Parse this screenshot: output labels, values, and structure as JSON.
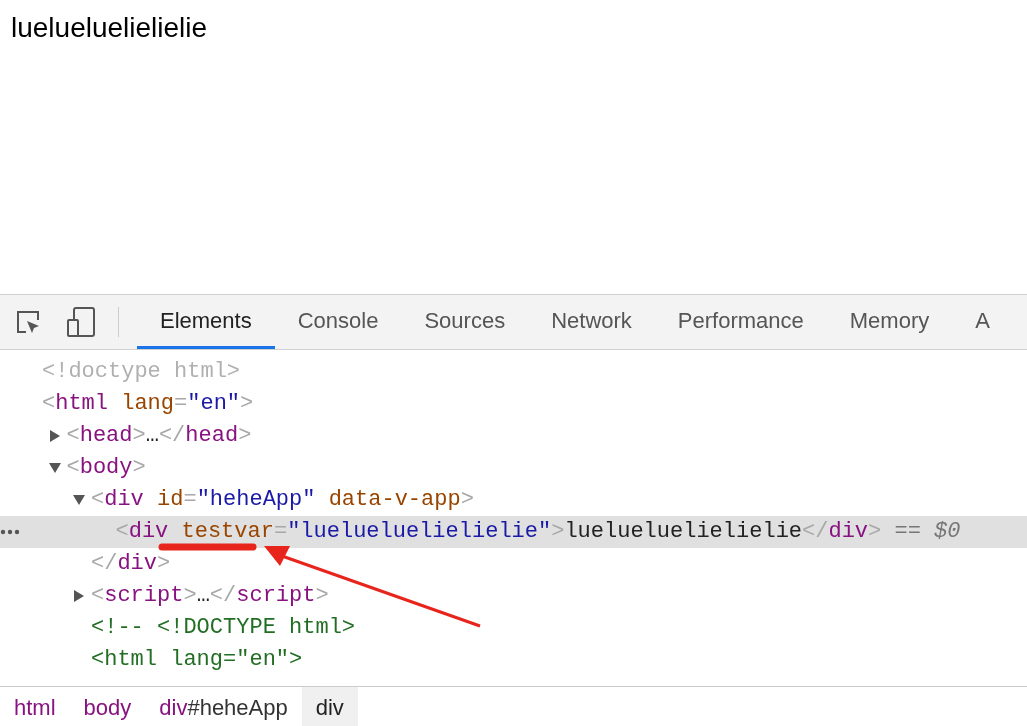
{
  "page": {
    "text": "luelueluelielielie"
  },
  "devtools": {
    "tabs": [
      {
        "label": "Elements",
        "selected": true
      },
      {
        "label": "Console",
        "selected": false
      },
      {
        "label": "Sources",
        "selected": false
      },
      {
        "label": "Network",
        "selected": false
      },
      {
        "label": "Performance",
        "selected": false
      },
      {
        "label": "Memory",
        "selected": false
      },
      {
        "label": "A",
        "selected": false
      }
    ],
    "dom_tree": [
      {
        "selected": false,
        "tokens": [
          {
            "kind": "doctype",
            "text": "<!doctype html>"
          }
        ]
      },
      {
        "selected": false,
        "tokens": [
          {
            "kind": "punct",
            "text": "<"
          },
          {
            "kind": "tag",
            "text": "html"
          },
          {
            "kind": "attr",
            "text": " lang"
          },
          {
            "kind": "punct",
            "text": "="
          },
          {
            "kind": "value",
            "text": "\"en\""
          },
          {
            "kind": "punct",
            "text": ">"
          }
        ],
        "children": [
          {
            "selected": false,
            "expanded": false,
            "tokens": [
              {
                "kind": "punct",
                "text": "<"
              },
              {
                "kind": "tag",
                "text": "head"
              },
              {
                "kind": "punct",
                "text": ">"
              },
              {
                "kind": "text",
                "text": "…"
              },
              {
                "kind": "punct",
                "text": "</"
              },
              {
                "kind": "tag",
                "text": "head"
              },
              {
                "kind": "punct",
                "text": ">"
              }
            ]
          },
          {
            "selected": false,
            "expanded": true,
            "tokens": [
              {
                "kind": "punct",
                "text": "<"
              },
              {
                "kind": "tag",
                "text": "body"
              },
              {
                "kind": "punct",
                "text": ">"
              }
            ],
            "children": [
              {
                "selected": false,
                "expanded": true,
                "tokens": [
                  {
                    "kind": "punct",
                    "text": "<"
                  },
                  {
                    "kind": "tag",
                    "text": "div"
                  },
                  {
                    "kind": "attr",
                    "text": " id"
                  },
                  {
                    "kind": "punct",
                    "text": "="
                  },
                  {
                    "kind": "value",
                    "text": "\"heheApp\""
                  },
                  {
                    "kind": "attr",
                    "text": " data-v-app"
                  },
                  {
                    "kind": "punct",
                    "text": ">"
                  }
                ],
                "children": [
                  {
                    "selected": true,
                    "tokens": [
                      {
                        "kind": "punct",
                        "text": "<"
                      },
                      {
                        "kind": "tag",
                        "text": "div"
                      },
                      {
                        "kind": "attr",
                        "text": " testvar"
                      },
                      {
                        "kind": "punct",
                        "text": "="
                      },
                      {
                        "kind": "value",
                        "text": "\"luelueluelielielie\""
                      },
                      {
                        "kind": "punct",
                        "text": ">"
                      },
                      {
                        "kind": "text",
                        "text": "luelueluelielielie"
                      },
                      {
                        "kind": "punct",
                        "text": "</"
                      },
                      {
                        "kind": "tag",
                        "text": "div"
                      },
                      {
                        "kind": "punct",
                        "text": ">"
                      },
                      {
                        "kind": "hint",
                        "text": " == $0"
                      }
                    ]
                  }
                ]
              },
              {
                "selected": false,
                "tokens": [
                  {
                    "kind": "punct",
                    "text": "</"
                  },
                  {
                    "kind": "tag",
                    "text": "div"
                  },
                  {
                    "kind": "punct",
                    "text": ">"
                  }
                ]
              },
              {
                "selected": false,
                "expanded": false,
                "tokens": [
                  {
                    "kind": "punct",
                    "text": "<"
                  },
                  {
                    "kind": "tag",
                    "text": "script"
                  },
                  {
                    "kind": "punct",
                    "text": ">"
                  },
                  {
                    "kind": "text",
                    "text": "…"
                  },
                  {
                    "kind": "punct",
                    "text": "</"
                  },
                  {
                    "kind": "tag",
                    "text": "script"
                  },
                  {
                    "kind": "punct",
                    "text": ">"
                  }
                ]
              },
              {
                "selected": false,
                "tokens": [
                  {
                    "kind": "comment",
                    "text": "<!-- <!DOCTYPE html>"
                  }
                ]
              },
              {
                "selected": false,
                "tokens": [
                  {
                    "kind": "comment",
                    "text": "<html lang=\"en\">"
                  }
                ]
              }
            ]
          }
        ]
      }
    ],
    "breadcrumbs": [
      {
        "tag": "html",
        "selected": false
      },
      {
        "tag": "body",
        "selected": false
      },
      {
        "tag": "div",
        "id": "#heheApp",
        "selected": false
      },
      {
        "tag": "div",
        "selected": true
      }
    ]
  }
}
